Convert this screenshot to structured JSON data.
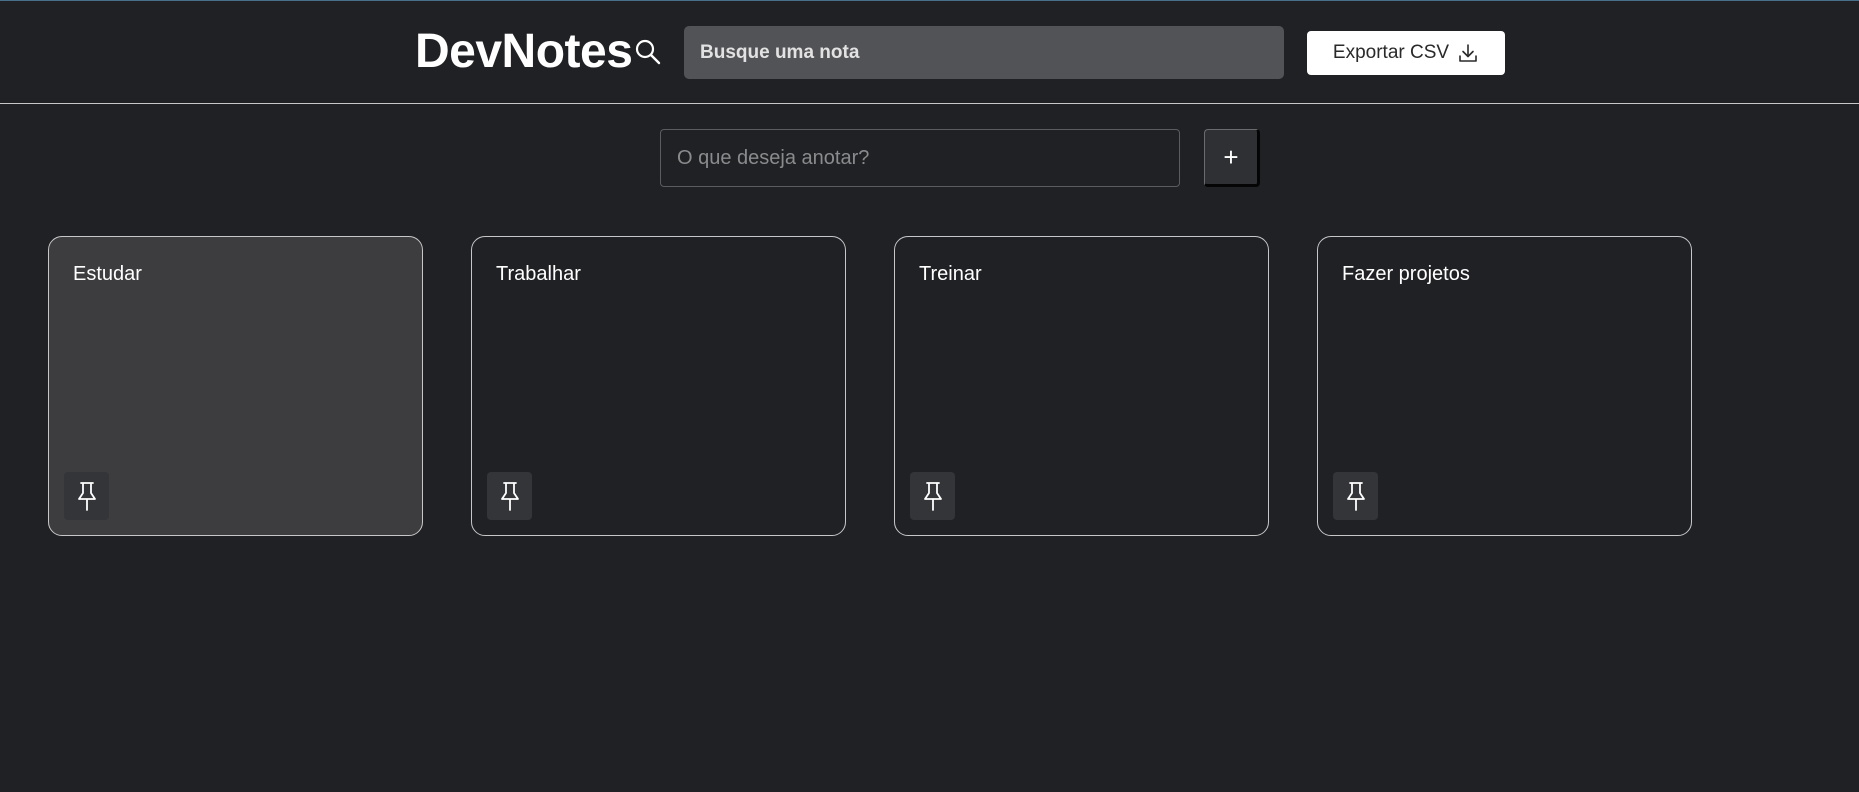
{
  "header": {
    "logo": "DevNotes",
    "search_icon": "search-icon",
    "search_placeholder": "Busque uma nota",
    "export_label": "Exportar CSV",
    "export_icon": "download-icon"
  },
  "composer": {
    "placeholder": "O que deseja anotar?",
    "add_label": "+"
  },
  "notes": [
    {
      "title": "Estudar",
      "selected": true,
      "pin_icon": "pin-icon"
    },
    {
      "title": "Trabalhar",
      "selected": false,
      "pin_icon": "pin-icon"
    },
    {
      "title": "Treinar",
      "selected": false,
      "pin_icon": "pin-icon"
    },
    {
      "title": "Fazer projetos",
      "selected": false,
      "pin_icon": "pin-icon"
    }
  ],
  "colors": {
    "background": "#202124",
    "search_bg": "#525356",
    "card_active_bg": "#3d3d3f",
    "card_border": "#c7c7c9"
  }
}
